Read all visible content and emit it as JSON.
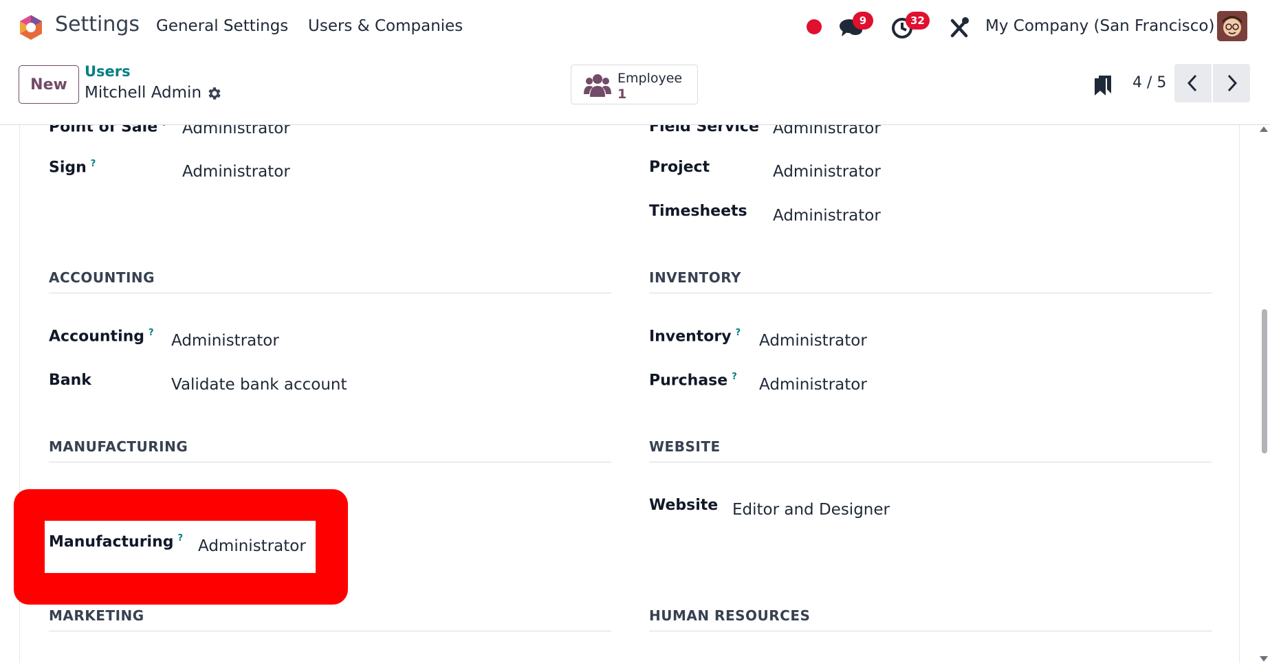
{
  "navbar": {
    "app_name": "Settings",
    "menu": [
      "General Settings",
      "Users & Companies"
    ],
    "messages_count": "9",
    "activities_count": "32",
    "company": "My Company (San Francisco)",
    "icons": [
      "odoo-logo-icon",
      "recording-dot-icon",
      "chat-icon",
      "clock-icon",
      "debug-tools-icon",
      "avatar"
    ]
  },
  "control": {
    "new_label": "New",
    "breadcrumb_parent": "Users",
    "record_name": "Mitchell Admin",
    "smart_button": {
      "label": "Employee",
      "value": "1"
    },
    "pager": "4 / 5"
  },
  "form": {
    "top_left": [
      {
        "label": "Point of Sale",
        "help": "?",
        "value": "Administrator"
      },
      {
        "label": "Sign",
        "help": "?",
        "value": "Administrator"
      }
    ],
    "top_right": [
      {
        "label": "Field Service",
        "value": "Administrator"
      },
      {
        "label": "Project",
        "value": "Administrator"
      },
      {
        "label": "Timesheets",
        "value": "Administrator"
      }
    ],
    "accounting": {
      "title": "ACCOUNTING",
      "fields": [
        {
          "label": "Accounting",
          "help": "?",
          "value": "Administrator"
        },
        {
          "label": "Bank",
          "value": "Validate bank account"
        }
      ]
    },
    "inventory": {
      "title": "INVENTORY",
      "fields": [
        {
          "label": "Inventory",
          "help": "?",
          "value": "Administrator"
        },
        {
          "label": "Purchase",
          "help": "?",
          "value": "Administrator"
        }
      ]
    },
    "manufacturing": {
      "title": "MANUFACTURING",
      "fields": [
        {
          "label": "Manufacturing",
          "help": "?",
          "value": "Administrator"
        }
      ]
    },
    "website": {
      "title": "WEBSITE",
      "fields": [
        {
          "label": "Website",
          "value": "Editor and Designer"
        }
      ]
    },
    "marketing": {
      "title": "MARKETING"
    },
    "human_resources": {
      "title": "HUMAN RESOURCES"
    }
  },
  "colors": {
    "brand": "#714b67",
    "link": "#017e84",
    "badge": "#e0102f",
    "highlight": "#ff0000"
  }
}
